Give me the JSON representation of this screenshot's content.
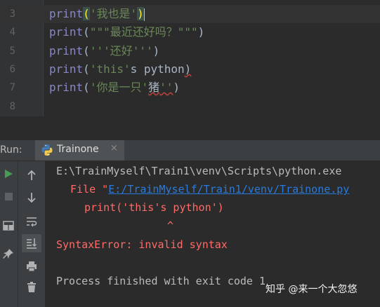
{
  "editor": {
    "lines": [
      {
        "number": "3",
        "kw": "print",
        "open": "(",
        "str": "'我也是'",
        "close": ")"
      },
      {
        "number": "4",
        "kw": "print",
        "open": "(",
        "str": "\"\"\"最近还好吗？\"\"\"",
        "close": ")"
      },
      {
        "number": "5",
        "kw": "print",
        "open": "(",
        "str": "'''还好'''",
        "close": ")"
      },
      {
        "number": "6",
        "kw": "print",
        "open": "(",
        "str": "'this'",
        "rest": "s python",
        "close": ")"
      },
      {
        "number": "7",
        "kw": "print",
        "open": "(",
        "str": "'你是一只'",
        "rest": "猪",
        "str2": "''",
        "close": ")"
      },
      {
        "number": "8"
      }
    ]
  },
  "run_window": {
    "label": "Run:",
    "tab_label": "Trainone",
    "tab_close": "×"
  },
  "console": {
    "lines": [
      "E:\\TrainMyself\\Train1\\venv\\Scripts\\python.exe",
      "File \"",
      "E:/TrainMyself/Train1/venv/Trainone.py",
      "print('this's python')",
      "^",
      "SyntaxError: invalid syntax",
      "Process finished with exit code 1"
    ]
  },
  "watermark": "知乎 @来一个大忽悠",
  "icons": [
    "python-icon",
    "run-icon",
    "stop-icon",
    "scroll-up-icon",
    "scroll-down-icon",
    "soft-wrap-icon",
    "scroll-to-end-icon",
    "layout-icon",
    "print-icon",
    "pin-icon",
    "delete-icon"
  ]
}
